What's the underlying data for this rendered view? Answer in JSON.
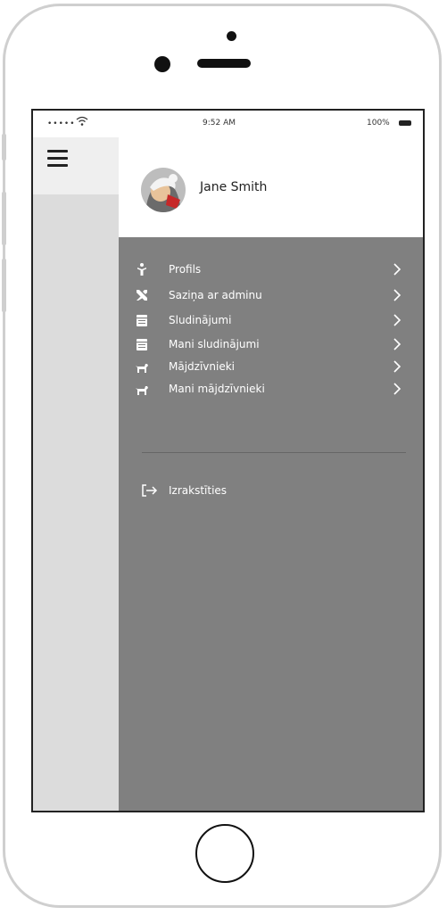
{
  "status_bar": {
    "signal": "•••••",
    "time": "9:52 AM",
    "battery": "100%"
  },
  "user": {
    "name": "Jane Smith"
  },
  "menu": {
    "items": [
      {
        "label": "Profils",
        "icon": "person-icon"
      },
      {
        "label": "Saziņa ar adminu",
        "icon": "tools-icon"
      },
      {
        "label": "Sludinājumi",
        "icon": "calendar-icon"
      },
      {
        "label": "Mani sludinājumi",
        "icon": "calendar-icon"
      },
      {
        "label": "Mājdzīvnieki",
        "icon": "dog-icon"
      },
      {
        "label": "Mani mājdzīvnieki",
        "icon": "dog-icon"
      }
    ],
    "logout": {
      "label": "Izrakstīties",
      "icon": "logout-icon"
    }
  },
  "colors": {
    "menu_background": "#808080",
    "side_panel": "#dcdcdc",
    "menu_text": "#ffffff"
  }
}
